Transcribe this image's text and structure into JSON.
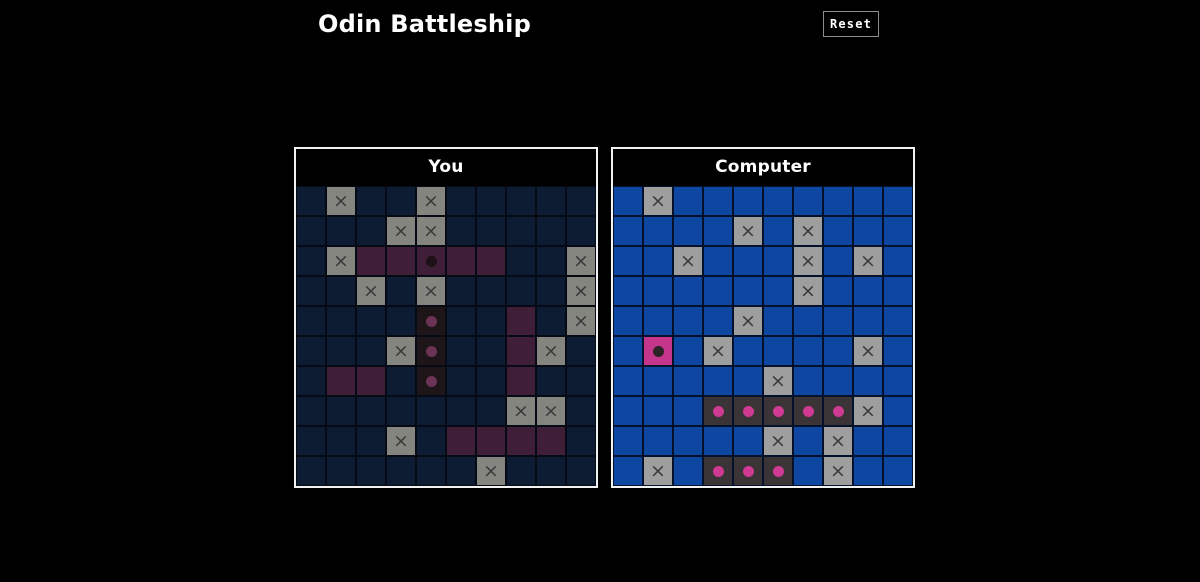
{
  "header": {
    "title": "Odin Battleship",
    "reset_label": "Reset"
  },
  "boards": [
    {
      "id": "you",
      "title": "You",
      "water_color": "#0d1b33",
      "ship_color": "#3f1f37",
      "miss_color": "#85857f",
      "hit_color": "#1d1518",
      "rows": 10,
      "cols": 10,
      "cells": [
        [
          "water",
          "miss",
          "water",
          "water",
          "miss",
          "water",
          "water",
          "water",
          "water",
          "water"
        ],
        [
          "water",
          "water",
          "water",
          "miss",
          "miss",
          "water",
          "water",
          "water",
          "water",
          "water"
        ],
        [
          "water",
          "miss",
          "ship",
          "ship",
          "sunk",
          "ship",
          "ship",
          "water",
          "water",
          "miss"
        ],
        [
          "water",
          "water",
          "miss",
          "water",
          "miss",
          "water",
          "water",
          "water",
          "water",
          "miss"
        ],
        [
          "water",
          "water",
          "water",
          "water",
          "hit",
          "water",
          "water",
          "ship",
          "water",
          "miss"
        ],
        [
          "water",
          "water",
          "water",
          "miss",
          "hit",
          "water",
          "water",
          "ship",
          "miss",
          "water"
        ],
        [
          "water",
          "ship",
          "ship",
          "water",
          "hit",
          "water",
          "water",
          "ship",
          "water",
          "water"
        ],
        [
          "water",
          "water",
          "water",
          "water",
          "water",
          "water",
          "water",
          "miss",
          "miss",
          "water"
        ],
        [
          "water",
          "water",
          "water",
          "miss",
          "water",
          "ship",
          "ship",
          "ship",
          "ship",
          "water"
        ],
        [
          "water",
          "water",
          "water",
          "water",
          "water",
          "water",
          "miss",
          "water",
          "water",
          "water"
        ]
      ]
    },
    {
      "id": "computer",
      "title": "Computer",
      "water_color": "#0d47a1",
      "miss_color": "#9e9e9e",
      "hit_color": "#3b3437",
      "sunk_color": "#c4358c",
      "rows": 10,
      "cols": 10,
      "cells": [
        [
          "water",
          "miss",
          "water",
          "water",
          "water",
          "water",
          "water",
          "water",
          "water",
          "water"
        ],
        [
          "water",
          "water",
          "water",
          "water",
          "miss",
          "water",
          "miss",
          "water",
          "water",
          "water"
        ],
        [
          "water",
          "water",
          "miss",
          "water",
          "water",
          "water",
          "miss",
          "water",
          "miss",
          "water"
        ],
        [
          "water",
          "water",
          "water",
          "water",
          "water",
          "water",
          "miss",
          "water",
          "water",
          "water"
        ],
        [
          "water",
          "water",
          "water",
          "water",
          "miss",
          "water",
          "water",
          "water",
          "water",
          "water"
        ],
        [
          "water",
          "sunk",
          "water",
          "miss",
          "water",
          "water",
          "water",
          "water",
          "miss",
          "water"
        ],
        [
          "water",
          "water",
          "water",
          "water",
          "water",
          "miss",
          "water",
          "water",
          "water",
          "water"
        ],
        [
          "water",
          "water",
          "water",
          "hit",
          "hit",
          "hit",
          "hit",
          "hit",
          "miss",
          "water"
        ],
        [
          "water",
          "water",
          "water",
          "water",
          "water",
          "miss",
          "water",
          "miss",
          "water",
          "water"
        ],
        [
          "water",
          "miss",
          "water",
          "hit",
          "hit",
          "hit",
          "water",
          "miss",
          "water",
          "water"
        ]
      ]
    }
  ],
  "icons": {
    "miss_glyph": "×",
    "hit_glyph": "●"
  }
}
